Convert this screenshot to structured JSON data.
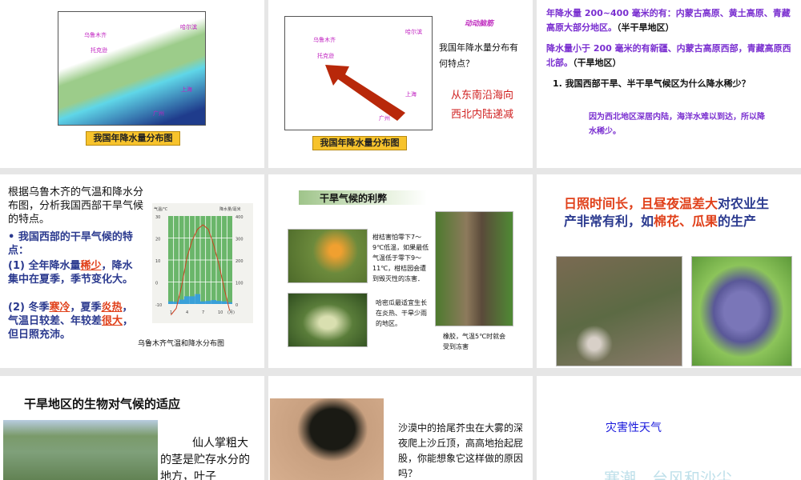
{
  "slides": [
    {
      "map_cities": [
        "哈尔滨",
        "乌鲁木齐",
        "托克逊",
        "上海",
        "广州"
      ],
      "caption": "我国年降水量分布图"
    },
    {
      "badge": "动动脑筋",
      "question": "我国年降水量分布有何特点？",
      "answer_line1": "从东南沿海向",
      "answer_line2": "西北内陆递减",
      "caption": "我国年降水量分布图",
      "map_cities": [
        "哈尔滨",
        "乌鲁木齐",
        "托克逊",
        "上海",
        "广州"
      ]
    },
    {
      "p1": "年降水量 200~400 毫米的有：内蒙古高原、黄土高原、青藏高原大部分地区。",
      "p1_tag": "（半干旱地区）",
      "p2": "降水量小于 200 毫米的有新疆、内蒙古高原西部，青藏高原西北部。",
      "p2_tag": "（干旱地区）",
      "q": "1. 我国西部干旱、半干旱气候区为什么降水稀少？",
      "a": "因为西北地区深居内陆，海洋水难以到达，所以降水稀少。"
    },
    {
      "intro": "根据乌鲁木齐的气温和降水分布图，分析我国西部干旱气候的特点。",
      "bullet": "我国西部的干旱气候的特点：",
      "l1a": "(1) 全年降水量",
      "l1_fill": "稀少",
      "l1b": "，降水集中在夏季，季节变化大。",
      "l2a": "(2) 冬季",
      "l2_fill1": "寒冷",
      "l2b": "，夏季",
      "l2_fill2": "炎热",
      "l2c": "，气温日较差、年较差",
      "l2_fill3": "很大",
      "l2d": "，但日照充沛。",
      "chart_caption": "乌鲁木齐气温和降水分布图"
    },
    {
      "title": "干旱气候的利弊",
      "text1": "柑桔害怕零下7～9℃低温，如果最低气温低于零下9～11℃，柑桔园会遭到毁灭性的冻害．",
      "text2": "哈密瓜最适宜生长在炎热、干旱少雨的地区。",
      "text3": "橡胶，气温5℃时就会受到冻害"
    },
    {
      "t1": "日照时间长，且",
      "t2": "昼夜温差大",
      "t3": "对农业生产非常有利，如",
      "t4": "棉花、瓜果",
      "t5": "的生产"
    },
    {
      "title": "干旱地区的生物对气候的适应",
      "text": "仙人掌粗大的茎是贮存水分的地方，叶子"
    },
    {
      "text": "沙漠中的拾尾芥虫在大雾的深夜爬上沙丘顶，高高地抬起屁股，你能想象它这样做的原因吗？"
    },
    {
      "title": "灾害性天气",
      "faded": "寒潮、台风和沙尘"
    }
  ],
  "chart_data": {
    "type": "bar+line",
    "title": "乌鲁木齐气温和降水分布图",
    "ylabel_left": "气温/℃",
    "ylabel_right": "降水量/毫米",
    "x": [
      1,
      2,
      3,
      4,
      5,
      6,
      7,
      8,
      9,
      10,
      11,
      12
    ],
    "x_ticks": [
      "1",
      "4",
      "7",
      "10",
      "(月)"
    ],
    "y_left_ticks": [
      "30",
      "20",
      "10",
      "0",
      "-10"
    ],
    "y_right_ticks": [
      "400",
      "300",
      "200",
      "100",
      "0"
    ],
    "temperature": [
      -15,
      -12,
      -2,
      11,
      19,
      24,
      26,
      24,
      17,
      8,
      -3,
      -13
    ],
    "precipitation": [
      12,
      10,
      20,
      35,
      35,
      45,
      12,
      14,
      18,
      14,
      12,
      8
    ],
    "ylim_left": [
      -10,
      30
    ],
    "ylim_right": [
      0,
      400
    ]
  }
}
